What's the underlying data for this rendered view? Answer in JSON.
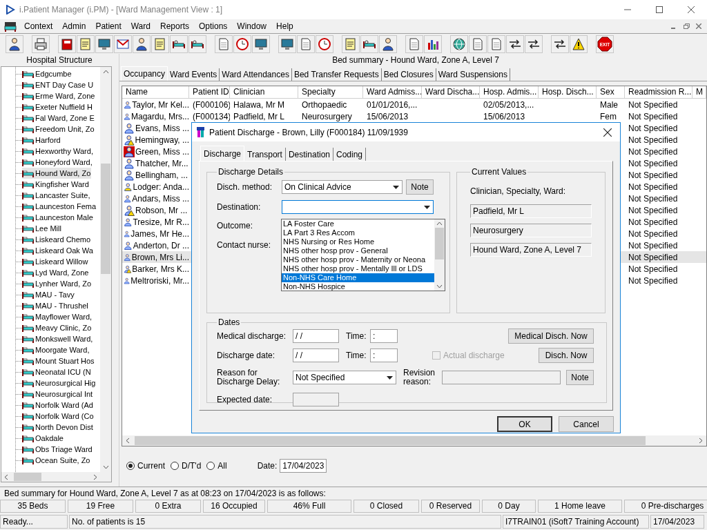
{
  "window": {
    "title": "i.Patient Manager (i.PM) - [Ward Management View : 1]"
  },
  "menu": [
    "Context",
    "Admin",
    "Patient",
    "Ward",
    "Reports",
    "Options",
    "Window",
    "Help"
  ],
  "toolbar": {
    "exit_label": "EXIT"
  },
  "hospital_structure": {
    "title": "Hospital Structure",
    "wards": [
      {
        "label": "Edgcumbe",
        "selected": false
      },
      {
        "label": "ENT Day Case U",
        "selected": false
      },
      {
        "label": "Erme Ward, Zone",
        "selected": false
      },
      {
        "label": "Exeter Nuffield H",
        "selected": false
      },
      {
        "label": "Fal Ward, Zone E",
        "selected": false
      },
      {
        "label": "Freedom Unit, Zo",
        "selected": false
      },
      {
        "label": "Harford",
        "selected": false
      },
      {
        "label": "Hexworthy Ward,",
        "selected": false
      },
      {
        "label": "Honeyford Ward,",
        "selected": false
      },
      {
        "label": "Hound Ward, Zo",
        "selected": true
      },
      {
        "label": "Kingfisher Ward",
        "selected": false
      },
      {
        "label": "Lancaster Suite,",
        "selected": false
      },
      {
        "label": "Launceston Fema",
        "selected": false
      },
      {
        "label": "Launceston Male",
        "selected": false
      },
      {
        "label": "Lee Mill",
        "selected": false
      },
      {
        "label": "Liskeard Chemo",
        "selected": false
      },
      {
        "label": "Liskeard Oak Wa",
        "selected": false
      },
      {
        "label": "Liskeard Willow",
        "selected": false
      },
      {
        "label": "Lyd Ward, Zone",
        "selected": false
      },
      {
        "label": "Lynher Ward, Zo",
        "selected": false
      },
      {
        "label": "MAU - Tavy",
        "selected": false
      },
      {
        "label": "MAU - Thrushel",
        "selected": false
      },
      {
        "label": "Mayflower Ward,",
        "selected": false
      },
      {
        "label": "Meavy Clinic, Zo",
        "selected": false
      },
      {
        "label": "Monkswell Ward,",
        "selected": false
      },
      {
        "label": "Moorgate Ward,",
        "selected": false
      },
      {
        "label": "Mount Stuart Hos",
        "selected": false
      },
      {
        "label": "Neonatal ICU (N",
        "selected": false
      },
      {
        "label": "Neurosurgical Hig",
        "selected": false
      },
      {
        "label": "Neurosurgical Int",
        "selected": false
      },
      {
        "label": "Norfolk Ward (Ad",
        "selected": false
      },
      {
        "label": "Norfolk Ward (Co",
        "selected": false
      },
      {
        "label": "North Devon Dist",
        "selected": false
      },
      {
        "label": "Oakdale",
        "selected": false
      },
      {
        "label": "Obs Triage Ward",
        "selected": false
      },
      {
        "label": "Ocean Suite, Zo",
        "selected": false
      }
    ]
  },
  "ward_view": {
    "header": "Bed summary - Hound Ward, Zone A, Level 7",
    "tabs": [
      {
        "label": "Occupancy",
        "selected": true
      },
      {
        "label": "Ward Events",
        "selected": false
      },
      {
        "label": "Ward Attendances",
        "selected": false
      },
      {
        "label": "Bed Transfer Requests",
        "selected": false
      },
      {
        "label": "Bed Closures",
        "selected": false
      },
      {
        "label": "Ward Suspensions",
        "selected": false
      }
    ],
    "table": {
      "columns": [
        "Name",
        "Patient ID",
        "Clinician",
        "Specialty",
        "Ward Admiss...",
        "Ward Discha...",
        "Hosp. Admis...",
        "Hosp. Disch...",
        "Sex",
        "Readmission R...",
        "M"
      ],
      "rows": [
        {
          "kind": "standard",
          "selected": false,
          "name": "Taylor, Mr Kel...",
          "patient_id": "(F000106)",
          "clinician": "Halawa, Mr M",
          "specialty": "Orthopaedic",
          "ward_admission": "01/01/2016,...",
          "hosp_admission": "02/05/2013,...",
          "sex": "Male",
          "readmission": "Not Specified"
        },
        {
          "kind": "standard",
          "selected": false,
          "name": "Magardu, Mrs...",
          "patient_id": "(F000134)",
          "clinician": "Padfield, Mr L",
          "specialty": "Neurosurgery",
          "ward_admission": "15/06/2013",
          "hosp_admission": "15/06/2013",
          "sex": "Fem",
          "readmission": "Not Specified"
        },
        {
          "kind": "standard",
          "selected": false,
          "name": "Evans, Miss ...",
          "readmission": "Not Specified"
        },
        {
          "kind": "alert",
          "selected": false,
          "name": "Hemingway, ...",
          "readmission": "Not Specified"
        },
        {
          "kind": "red",
          "selected": false,
          "name": "Green, Miss ...",
          "readmission": "Not Specified"
        },
        {
          "kind": "standard",
          "selected": false,
          "name": "Thatcher, Mr...",
          "readmission": "Not Specified"
        },
        {
          "kind": "standard",
          "selected": false,
          "name": "Bellingham, ...",
          "readmission": "Not Specified"
        },
        {
          "kind": "yellow",
          "selected": false,
          "name": "Lodger: Anda...",
          "readmission": "Not Specified"
        },
        {
          "kind": "standard",
          "selected": false,
          "name": "Andars, Miss ...",
          "readmission": "Not Specified"
        },
        {
          "kind": "alert",
          "selected": false,
          "name": "Robson, Mr ...",
          "readmission": "Not Specified"
        },
        {
          "kind": "standard",
          "selected": false,
          "name": "Tresize, Mr R...",
          "readmission": "Not Specified"
        },
        {
          "kind": "standard",
          "selected": false,
          "name": "James, Mr He...",
          "readmission": "Not Specified"
        },
        {
          "kind": "standard",
          "selected": false,
          "name": "Anderton, Dr ...",
          "readmission": "Not Specified"
        },
        {
          "kind": "standard",
          "selected": true,
          "name": "Brown, Mrs Li...",
          "readmission": "Not Specified"
        },
        {
          "kind": "alert",
          "selected": false,
          "name": "Barker, Mrs K...",
          "readmission": "Not Specified"
        },
        {
          "kind": "standard",
          "selected": false,
          "name": "Meltroriski, Mr...",
          "readmission": "Not Specified"
        }
      ]
    },
    "filters": [
      {
        "label": "Current",
        "selected": true
      },
      {
        "label": "D/T'd",
        "selected": false
      },
      {
        "label": "All",
        "selected": false
      }
    ],
    "date": {
      "label": "Date:",
      "value": "17/04/2023"
    }
  },
  "dialog": {
    "title": "Patient Discharge - Brown, Lilly (F000184) 11/09/1939",
    "tabs": [
      {
        "label": "Discharge",
        "selected": true
      },
      {
        "label": "Transport",
        "selected": false
      },
      {
        "label": "Destination",
        "selected": false
      },
      {
        "label": "Coding",
        "selected": false
      }
    ],
    "discharge_details": {
      "title": "Discharge Details",
      "disch_method": {
        "label": "Disch. method:",
        "value": "On Clinical Advice"
      },
      "note_button": "Note",
      "destination": {
        "label": "Destination:",
        "expanded": true,
        "options": [
          {
            "label": "LA Foster Care",
            "selected": false
          },
          {
            "label": "LA Part 3 Res Accom",
            "selected": false
          },
          {
            "label": "NHS Nursing or Res Home",
            "selected": false
          },
          {
            "label": "NHS other hosp prov - General",
            "selected": false
          },
          {
            "label": "NHS other hosp prov - Maternity or Neona",
            "selected": false
          },
          {
            "label": "NHS other hosp prov - Mentally Ill or LDS",
            "selected": false
          },
          {
            "label": "Non-NHS Care Home",
            "selected": true
          },
          {
            "label": "Non-NHS Hospice",
            "selected": false
          }
        ]
      },
      "outcome_label": "Outcome:",
      "contact_nurse_label": "Contact nurse:"
    },
    "current_values": {
      "title": "Current Values",
      "label": "Clinician, Specialty, Ward:",
      "values": [
        "Padfield, Mr L",
        "Neurosurgery",
        "Hound Ward, Zone A, Level 7"
      ]
    },
    "dates": {
      "title": "Dates",
      "medical_discharge": {
        "label": "Medical discharge:",
        "value": "/ /"
      },
      "medical_time": {
        "label": "Time:",
        "value": ":"
      },
      "medical_now_button": "Medical Disch. Now",
      "discharge_date": {
        "label": "Discharge date:",
        "value": "/ /"
      },
      "discharge_time": {
        "label": "Time:",
        "value": ":"
      },
      "actual_discharge": {
        "label": "Actual discharge",
        "checked": false,
        "disabled": true
      },
      "disch_now_button": "Disch. Now",
      "delay_reason": {
        "label": "Reason for Discharge Delay:",
        "value": "Not Specified"
      },
      "revision_reason": {
        "label": "Revision reason:",
        "disabled": true
      },
      "note_button": "Note",
      "expected_date": {
        "label": "Expected date:",
        "disabled": true
      }
    },
    "buttons": [
      {
        "label": "OK",
        "default": true
      },
      {
        "label": "Cancel",
        "default": false
      }
    ]
  },
  "summary_text": "Bed summary for Hound Ward, Zone A, Level 7 as at 08:23 on 17/04/2023 is as follows:",
  "bed_summary": [
    "35 Beds",
    "19 Free",
    "0 Extra",
    "16 Occupied",
    "46% Full",
    "0 Closed",
    "0 Reserved",
    "0 Day",
    "1 Home leave",
    "0 Pre-discharges"
  ],
  "status_bar": [
    "Ready...",
    "No. of patients is 15",
    "I7TRAIN01 (iSoft7 Training Account)",
    "17/04/2023"
  ]
}
